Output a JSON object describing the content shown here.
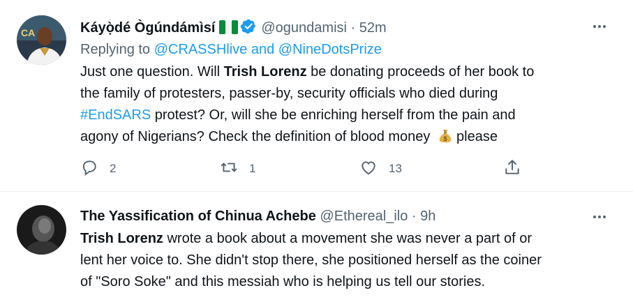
{
  "tweets": [
    {
      "name": "Káyọ̀dé Ògúndámìsí",
      "handle": "@ogundamisi",
      "sep": "·",
      "time": "52m",
      "replying_prefix": "Replying to ",
      "replying_users": "@CRASSHlive and @NineDotsPrize",
      "body": {
        "l1a": "Just one question. Will ",
        "l1b": "Trish Lorenz",
        "l1c": " be donating proceeds of her book to",
        "l2": "the family of protesters, passer-by, security officials who died during",
        "l3a": "#EndSARS",
        "l3b": " protest? Or, will she be enriching herself from the pain and",
        "l4a": "agony of Nigerians? Check the definition of blood money",
        "l4b": "please"
      },
      "counts": {
        "reply": "2",
        "retweet": "1",
        "like": "13"
      }
    },
    {
      "name": "The Yassification of Chinua Achebe",
      "handle": "@Ethereal_ilo",
      "sep": "·",
      "time": "9h",
      "body": {
        "l1a": "Trish Lorenz",
        "l1b": " wrote a book about a movement she was never a part of or",
        "l2": "lent her voice to. She didn't stop there, she positioned herself as the coiner",
        "l3": "of \"Soro Soke\" and this messiah who is helping us tell our stories."
      }
    }
  ],
  "icons": {
    "flag": "nigeria-flag-icon",
    "verified": "verified-badge-icon",
    "money": "money-bag-icon",
    "more": "more-icon",
    "reply": "reply-icon",
    "retweet": "retweet-icon",
    "like": "like-icon",
    "share": "share-icon"
  },
  "colors": {
    "accent": "#1d9bf0",
    "muted": "#536471",
    "text": "#0f1419",
    "divider": "#eff3f4"
  }
}
